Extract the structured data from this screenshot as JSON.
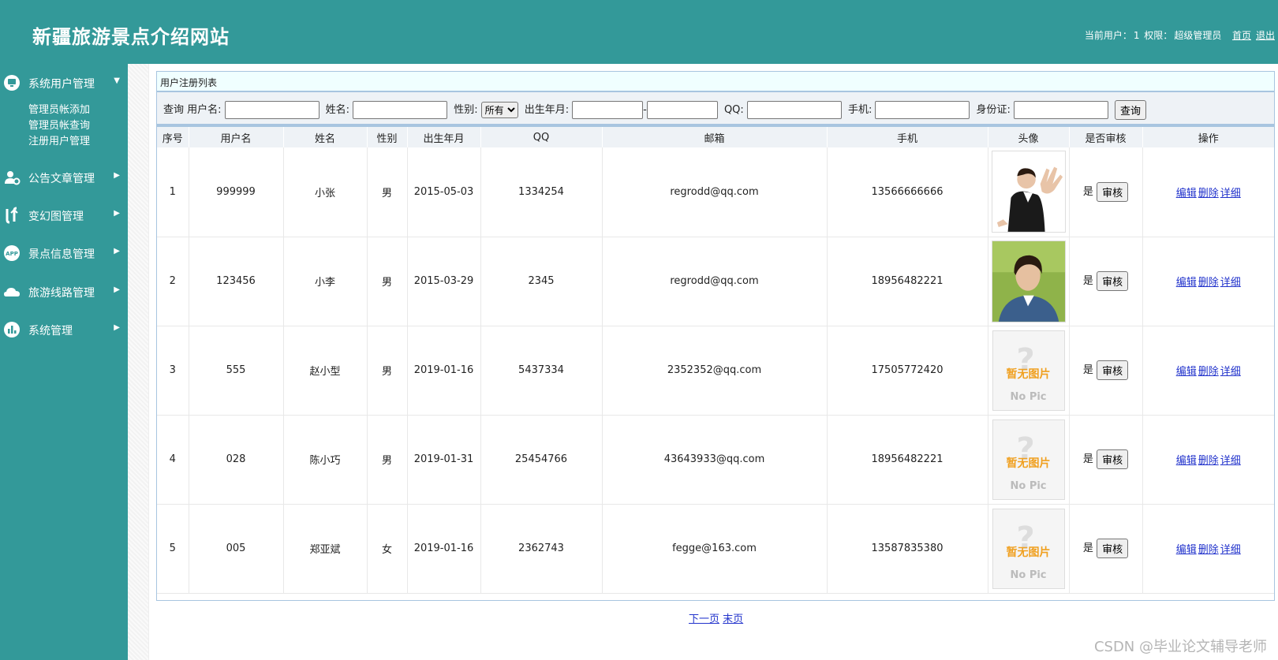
{
  "header": {
    "title": "新疆旅游景点介绍网站",
    "current_user_label": "当前用户：",
    "current_user": "1",
    "role_label": "权限：",
    "role": "超级管理员",
    "home_link": "首页",
    "logout_link": "退出"
  },
  "sidebar": {
    "groups": [
      {
        "label": "系统用户管理",
        "icon": "monitor-user-icon",
        "expanded": true
      },
      {
        "label": "公告文章管理",
        "icon": "user-gear-icon"
      },
      {
        "label": "变幻图管理",
        "icon": "exchange-icon"
      },
      {
        "label": "景点信息管理",
        "icon": "app-icon"
      },
      {
        "label": "旅游线路管理",
        "icon": "cloud-icon"
      },
      {
        "label": "系统管理",
        "icon": "chart-icon"
      }
    ],
    "submenu": [
      "管理员帐添加",
      "管理员帐查询",
      "注册用户管理"
    ]
  },
  "panel": {
    "title": "用户注册列表"
  },
  "search": {
    "query_label": "查询 用户名:",
    "name_label": "姓名:",
    "gender_label": "性别:",
    "gender_selected": "所有",
    "birth_label": "出生年月:",
    "birth_sep": "-",
    "qq_label": "QQ:",
    "phone_label": "手机:",
    "id_label": "身份证:",
    "button": "查询"
  },
  "table": {
    "columns": [
      "序号",
      "用户名",
      "姓名",
      "性别",
      "出生年月",
      "QQ",
      "邮箱",
      "手机",
      "头像",
      "是否审核",
      "操作"
    ],
    "rows": [
      {
        "no": "1",
        "username": "999999",
        "name": "小张",
        "gender": "男",
        "birth": "2015-05-03",
        "qq": "1334254",
        "email": "regrodd@qq.com",
        "phone": "13566666666",
        "avatar": "photo-man-pose",
        "audited": "是"
      },
      {
        "no": "2",
        "username": "123456",
        "name": "小李",
        "gender": "男",
        "birth": "2015-03-29",
        "qq": "2345",
        "email": "regrodd@qq.com",
        "phone": "18956482221",
        "avatar": "photo-man-portrait",
        "audited": "是"
      },
      {
        "no": "3",
        "username": "555",
        "name": "赵小型",
        "gender": "男",
        "birth": "2019-01-16",
        "qq": "5437334",
        "email": "2352352@qq.com",
        "phone": "17505772420",
        "avatar": "no-pic",
        "audited": "是"
      },
      {
        "no": "4",
        "username": "028",
        "name": "陈小巧",
        "gender": "男",
        "birth": "2019-01-31",
        "qq": "25454766",
        "email": "43643933@qq.com",
        "phone": "18956482221",
        "avatar": "no-pic",
        "audited": "是"
      },
      {
        "no": "5",
        "username": "005",
        "name": "郑亚斌",
        "gender": "女",
        "birth": "2019-01-16",
        "qq": "2362743",
        "email": "fegge@163.com",
        "phone": "13587835380",
        "avatar": "no-pic",
        "audited": "是"
      }
    ],
    "audit_button": "审核",
    "op_edit": "编辑",
    "op_delete": "删除",
    "op_detail": "详细",
    "nopic_cn": "暂无图片",
    "nopic_en": "No Pic",
    "nopic_q": "?"
  },
  "pager": {
    "next": "下一页",
    "last": "末页"
  },
  "watermark": "CSDN @毕业论文辅导老师",
  "colors": {
    "theme": "#339999",
    "table_border": "#a8c5e0",
    "link": "#2233cc"
  }
}
